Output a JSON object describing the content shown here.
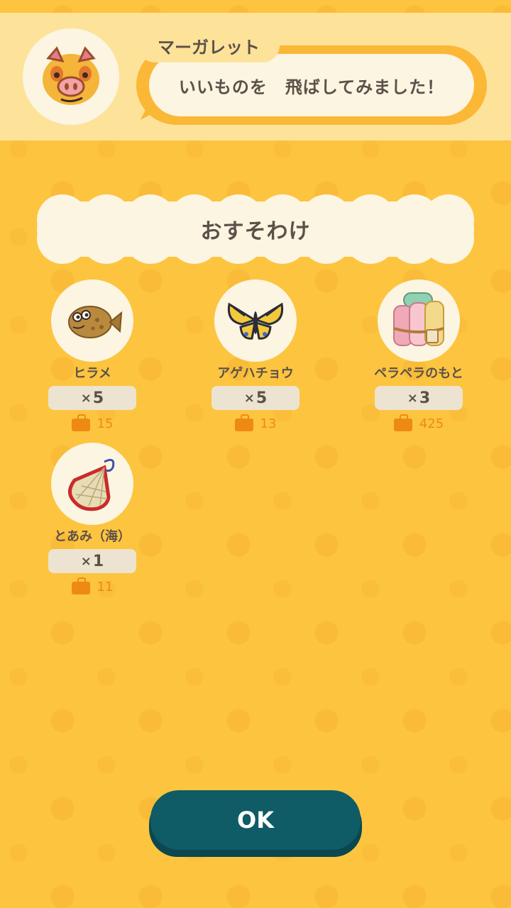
{
  "speaker": {
    "name": "マーガレット",
    "message": "いいものを　飛ばしてみました！",
    "avatar_icon": "pig-villager-avatar-icon"
  },
  "section_title": "おすそわけ",
  "items": [
    {
      "name": "ヒラメ",
      "quantity_prefix": "×",
      "quantity": "5",
      "price": "15",
      "icon": "flounder-fish-icon"
    },
    {
      "name": "アゲハチョウ",
      "quantity_prefix": "×",
      "quantity": "5",
      "price": "13",
      "icon": "swallowtail-butterfly-icon"
    },
    {
      "name": "ペラペラのもと",
      "quantity_prefix": "×",
      "quantity": "3",
      "price": "425",
      "icon": "fabric-rolls-icon"
    },
    {
      "name": "とあみ（海）",
      "quantity_prefix": "×",
      "quantity": "1",
      "price": "11",
      "icon": "cast-net-icon"
    }
  ],
  "price_icon": "bag-icon",
  "ok_button": {
    "label": "OK"
  },
  "colors": {
    "background": "#fdc43f",
    "header": "#fde29a",
    "cream": "#fbf5e2",
    "accent_orange": "#ee8a12",
    "button_teal": "#0f5b66"
  }
}
